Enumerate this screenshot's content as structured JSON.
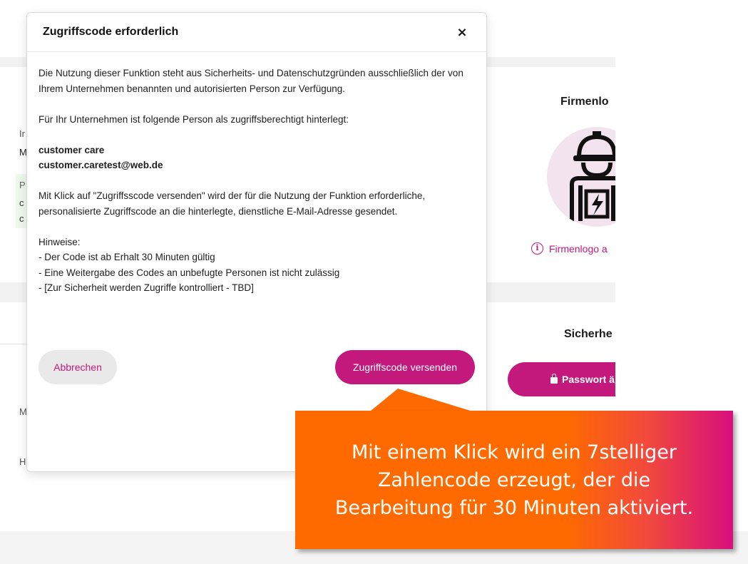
{
  "background": {
    "logo_card_title": "Firmenlo",
    "logo_hint": "Firmenlogo a",
    "security_card_title": "Sicherhe",
    "password_button": "Passwort ä",
    "left_letters": [
      "Ir",
      "M",
      "P",
      "c",
      "c",
      "M",
      "H"
    ]
  },
  "modal": {
    "title": "Zugriffscode erforderlich",
    "close_symbol": "×",
    "intro": "Die Nutzung dieser Funktion steht aus Sicherheits- und Datenschutzgründen ausschließlich der von Ihrem Unternehmen benannten und autorisierten Person zur Verfügung.",
    "person_intro": "Für Ihr Unternehmen ist folgende Person als zugriffsberechtigt hinterlegt:",
    "person_name": "customer care",
    "person_email": "customer.caretest@web.de",
    "explanation": "Mit Klick auf \"Zugriffsscode versenden\" wird der für die Nutzung der Funktion erforderliche, personalisierte Zugriffscode an die hinterlegte, dienstliche E-Mail-Adresse gesendet.",
    "notes_title": "Hinweise:",
    "notes": [
      "- Der Code ist ab Erhalt 30 Minuten gültig",
      "- Eine Weitergabe des Codes an unbefugte Personen ist nicht zulässig",
      "- [Zur Sicherheit werden Zugriffe kontrolliert - TBD]"
    ],
    "cancel_label": "Abbrechen",
    "send_label": "Zugriffscode versenden"
  },
  "callout": {
    "text": "Mit einem Klick wird ein 7stelliger\nZahlencode erzeugt, der die\nBearbeitung für 30 Minuten aktiviert."
  },
  "colors": {
    "brand": "#c3197c",
    "callout_orange": "#ff6a00",
    "callout_pink": "#d80f7d"
  }
}
